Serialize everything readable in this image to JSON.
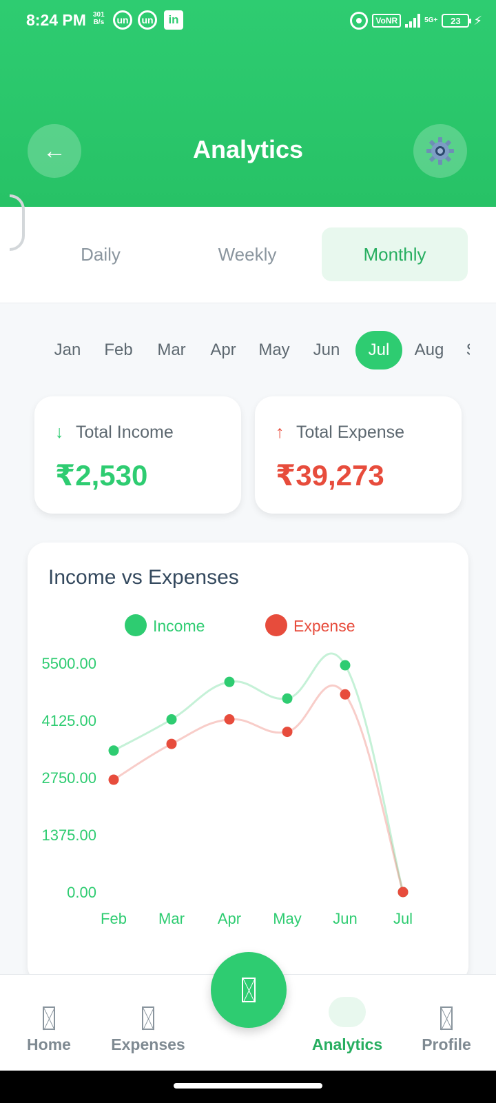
{
  "status": {
    "time": "8:24 PM",
    "speed_value": "301",
    "speed_unit": "B/s",
    "app_icons": [
      "un",
      "un",
      "in"
    ],
    "vonr": "VoNR",
    "network": "5G+",
    "battery": "23"
  },
  "header": {
    "title": "Analytics",
    "back_icon": "arrow-left-icon",
    "settings_icon": "gear-icon"
  },
  "tabs": [
    {
      "label": "Daily",
      "active": false
    },
    {
      "label": "Weekly",
      "active": false
    },
    {
      "label": "Monthly",
      "active": true
    }
  ],
  "months": [
    "Jan",
    "Feb",
    "Mar",
    "Apr",
    "May",
    "Jun",
    "Jul",
    "Aug",
    "Sep"
  ],
  "selected_month": "Jul",
  "summary": {
    "income": {
      "label": "Total Income",
      "value": "₹2,530",
      "arrow": "↓"
    },
    "expense": {
      "label": "Total Expense",
      "value": "₹39,273",
      "arrow": "↑"
    }
  },
  "chart_data": {
    "type": "line",
    "title": "Income vs Expenses",
    "x": [
      "Feb",
      "Mar",
      "Apr",
      "May",
      "Jun",
      "Jul"
    ],
    "series": [
      {
        "name": "Income",
        "color": "#2ecc71",
        "values": [
          3400,
          4150,
          5050,
          4650,
          5450,
          0
        ]
      },
      {
        "name": "Expense",
        "color": "#e74c3c",
        "values": [
          2700,
          3560,
          4150,
          3850,
          4750,
          0
        ]
      }
    ],
    "y_ticks": [
      "5500.00",
      "4125.00",
      "2750.00",
      "1375.00",
      "0.00"
    ],
    "ylim": [
      0,
      5500
    ],
    "legend_position": "top-center",
    "grid": false
  },
  "bottom_nav": {
    "items": [
      {
        "label": "Home",
        "icon": "home-icon",
        "active": false
      },
      {
        "label": "Expenses",
        "icon": "expenses-icon",
        "active": false
      },
      {
        "label": "Analytics",
        "icon": "analytics-icon",
        "active": true
      },
      {
        "label": "Profile",
        "icon": "profile-icon",
        "active": false
      }
    ],
    "fab_icon": "add-icon"
  },
  "colors": {
    "brand": "#2ecc71",
    "income": "#2ecc71",
    "expense": "#e74c3c"
  }
}
